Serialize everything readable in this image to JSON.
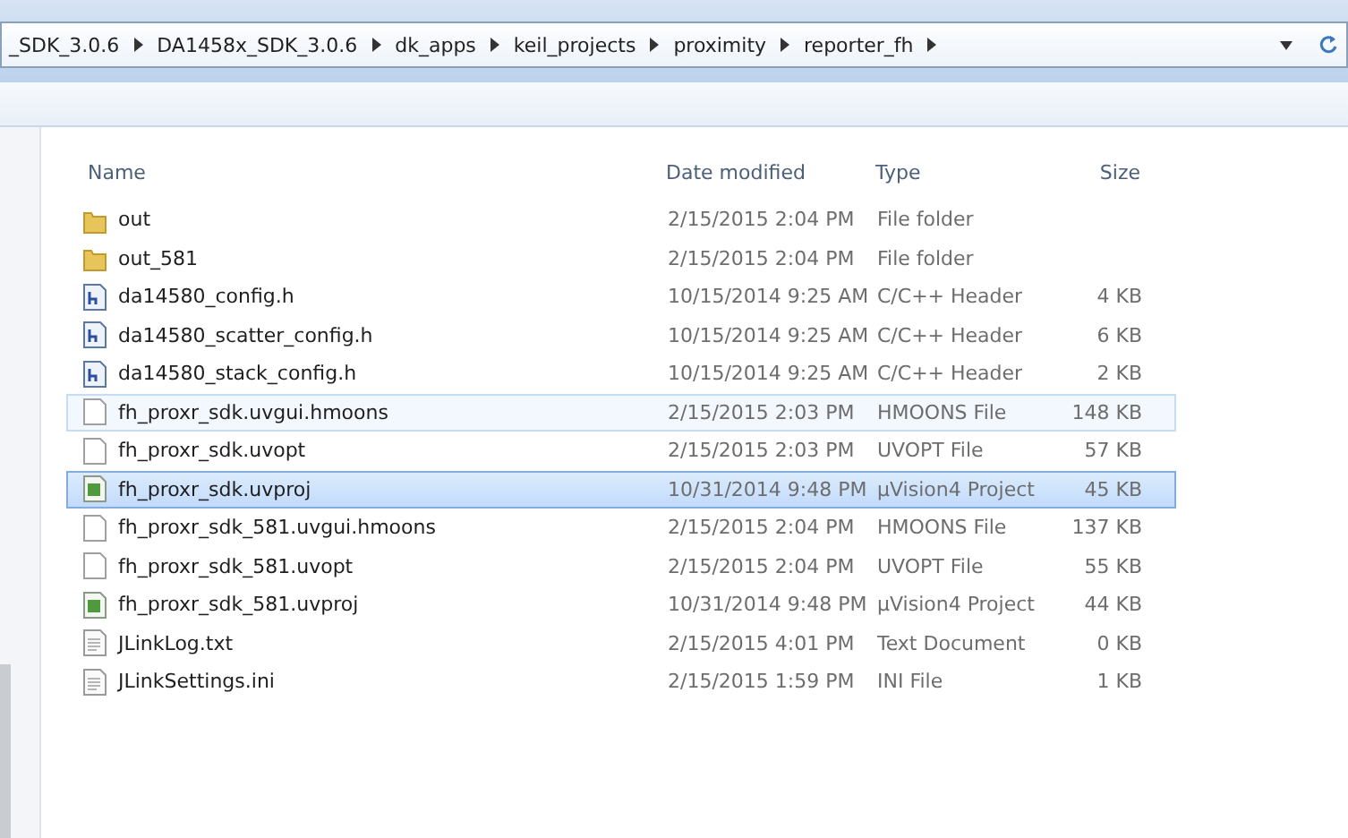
{
  "breadcrumb": [
    "_SDK_3.0.6",
    "DA1458x_SDK_3.0.6",
    "dk_apps",
    "keil_projects",
    "proximity",
    "reporter_fh"
  ],
  "columns": [
    "Name",
    "Date modified",
    "Type",
    "Size"
  ],
  "rows": [
    {
      "kind": "folder",
      "name": "out",
      "date": "2/15/2015 2:04 PM",
      "type": "File folder",
      "size": "",
      "selected": false,
      "hovered": false
    },
    {
      "kind": "folder",
      "name": "out_581",
      "date": "2/15/2015 2:04 PM",
      "type": "File folder",
      "size": "",
      "selected": false,
      "hovered": false
    },
    {
      "kind": "header",
      "name": "da14580_config.h",
      "date": "10/15/2014 9:25 AM",
      "type": "C/C++ Header",
      "size": "4 KB",
      "selected": false,
      "hovered": false
    },
    {
      "kind": "header",
      "name": "da14580_scatter_config.h",
      "date": "10/15/2014 9:25 AM",
      "type": "C/C++ Header",
      "size": "6 KB",
      "selected": false,
      "hovered": false
    },
    {
      "kind": "header",
      "name": "da14580_stack_config.h",
      "date": "10/15/2014 9:25 AM",
      "type": "C/C++ Header",
      "size": "2 KB",
      "selected": false,
      "hovered": false
    },
    {
      "kind": "file",
      "name": "fh_proxr_sdk.uvgui.hmoons",
      "date": "2/15/2015 2:03 PM",
      "type": "HMOONS File",
      "size": "148 KB",
      "selected": false,
      "hovered": true
    },
    {
      "kind": "file",
      "name": "fh_proxr_sdk.uvopt",
      "date": "2/15/2015 2:03 PM",
      "type": "UVOPT File",
      "size": "57 KB",
      "selected": false,
      "hovered": false
    },
    {
      "kind": "project",
      "name": "fh_proxr_sdk.uvproj",
      "date": "10/31/2014 9:48 PM",
      "type": "µVision4 Project",
      "size": "45 KB",
      "selected": true,
      "hovered": false
    },
    {
      "kind": "file",
      "name": "fh_proxr_sdk_581.uvgui.hmoons",
      "date": "2/15/2015 2:04 PM",
      "type": "HMOONS File",
      "size": "137 KB",
      "selected": false,
      "hovered": false
    },
    {
      "kind": "file",
      "name": "fh_proxr_sdk_581.uvopt",
      "date": "2/15/2015 2:04 PM",
      "type": "UVOPT File",
      "size": "55 KB",
      "selected": false,
      "hovered": false
    },
    {
      "kind": "project",
      "name": "fh_proxr_sdk_581.uvproj",
      "date": "10/31/2014 9:48 PM",
      "type": "µVision4 Project",
      "size": "44 KB",
      "selected": false,
      "hovered": false
    },
    {
      "kind": "text",
      "name": "JLinkLog.txt",
      "date": "2/15/2015 4:01 PM",
      "type": "Text Document",
      "size": "0 KB",
      "selected": false,
      "hovered": false
    },
    {
      "kind": "text",
      "name": "JLinkSettings.ini",
      "date": "2/15/2015 1:59 PM",
      "type": "INI File",
      "size": "1 KB",
      "selected": false,
      "hovered": false
    }
  ]
}
